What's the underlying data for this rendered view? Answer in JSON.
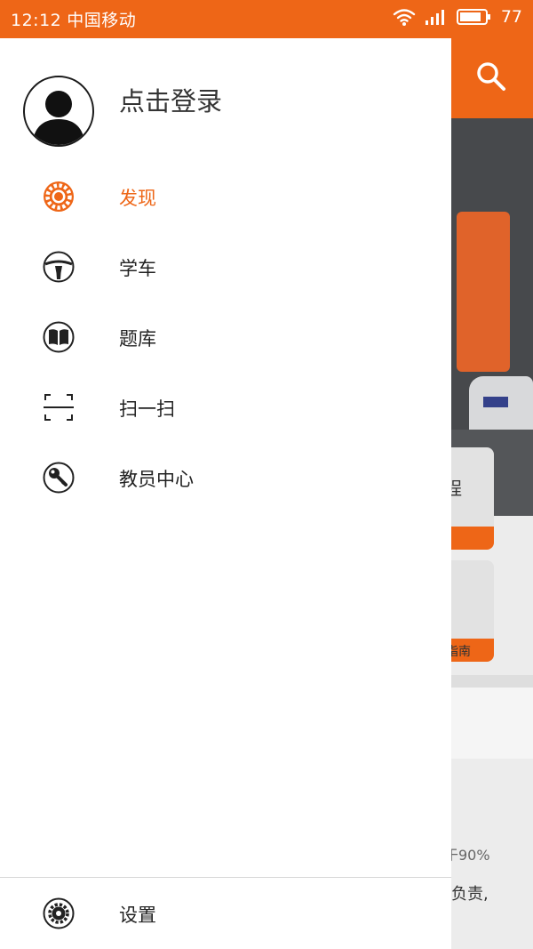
{
  "status_bar": {
    "time": "12:12",
    "carrier": "中国移动",
    "battery": "77"
  },
  "drawer": {
    "login_text": "点击登录",
    "menu": [
      {
        "label": "发现",
        "icon": "discover-icon",
        "active": true
      },
      {
        "label": "学车",
        "icon": "steering-wheel-icon",
        "active": false
      },
      {
        "label": "题库",
        "icon": "book-icon",
        "active": false
      },
      {
        "label": "扫一扫",
        "icon": "scan-icon",
        "active": false
      },
      {
        "label": "教员中心",
        "icon": "key-icon",
        "active": false
      }
    ],
    "settings_label": "设置"
  },
  "background_app": {
    "card1_text": "程",
    "card2_text": "指南",
    "snippet1": "于90%",
    "snippet2": "负责,"
  },
  "colors": {
    "accent": "#ee6617",
    "text": "#222222"
  }
}
